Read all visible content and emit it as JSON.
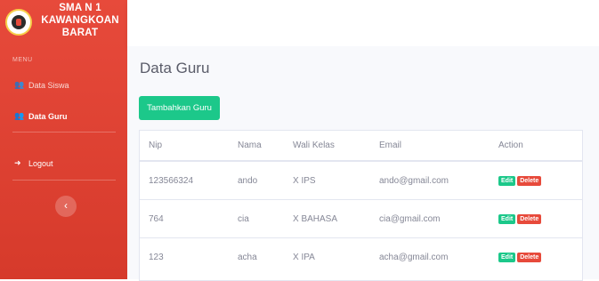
{
  "sidebar": {
    "brand": [
      "SMA N 1",
      "KAWANGKOAN",
      "BARAT"
    ],
    "menu_label": "MENU",
    "items": [
      {
        "label": "Data Siswa",
        "icon": "users-icon"
      },
      {
        "label": "Data Guru",
        "icon": "users-icon"
      },
      {
        "label": "Logout",
        "icon": "logout-icon"
      }
    ],
    "toggle": "‹"
  },
  "main": {
    "title": "Data Guru",
    "add_button": "Tambahkan Guru",
    "table": {
      "headers": [
        "Nip",
        "Nama",
        "Wali Kelas",
        "Email",
        "Action"
      ],
      "rows": [
        {
          "nip": "123566324",
          "nama": "ando",
          "wali": "X IPS",
          "email": "ando@gmail.com"
        },
        {
          "nip": "764",
          "nama": "cia",
          "wali": "X BAHASA",
          "email": "cia@gmail.com"
        },
        {
          "nip": "123",
          "nama": "acha",
          "wali": "X IPA",
          "email": "acha@gmail.com"
        }
      ],
      "edit_label": "Edit",
      "delete_label": "Delete"
    }
  },
  "colors": {
    "sidebar": "#e74a3b",
    "success": "#1cc88a",
    "danger": "#e74a3b"
  }
}
